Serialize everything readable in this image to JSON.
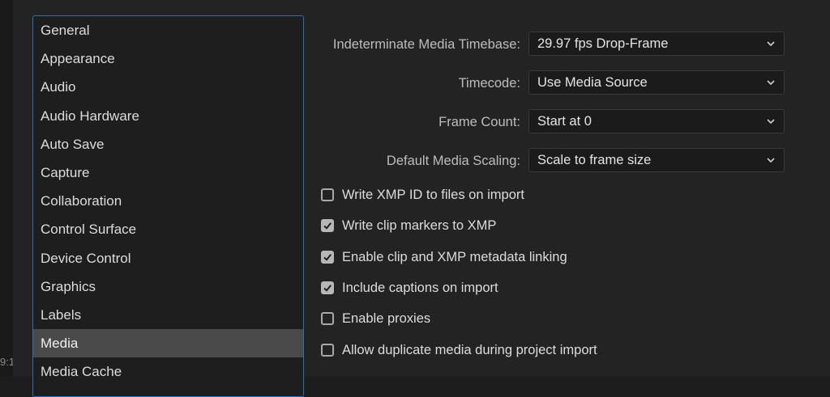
{
  "gutter": {
    "text": "9:1"
  },
  "sidebar": {
    "items": [
      {
        "label": "General"
      },
      {
        "label": "Appearance"
      },
      {
        "label": "Audio"
      },
      {
        "label": "Audio Hardware"
      },
      {
        "label": "Auto Save"
      },
      {
        "label": "Capture"
      },
      {
        "label": "Collaboration"
      },
      {
        "label": "Control Surface"
      },
      {
        "label": "Device Control"
      },
      {
        "label": "Graphics"
      },
      {
        "label": "Labels"
      },
      {
        "label": "Media"
      },
      {
        "label": "Media Cache"
      }
    ],
    "selected": "Media"
  },
  "media": {
    "timebase": {
      "label": "Indeterminate Media Timebase:",
      "value": "29.97 fps Drop-Frame"
    },
    "timecode": {
      "label": "Timecode:",
      "value": "Use Media Source"
    },
    "frame_count": {
      "label": "Frame Count:",
      "value": "Start at 0"
    },
    "scaling": {
      "label": "Default Media Scaling:",
      "value": "Scale to frame size"
    },
    "checkboxes": [
      {
        "label": "Write XMP ID to files on import",
        "checked": false
      },
      {
        "label": "Write clip markers to XMP",
        "checked": true
      },
      {
        "label": "Enable clip and XMP metadata linking",
        "checked": true
      },
      {
        "label": "Include captions on import",
        "checked": true
      },
      {
        "label": "Enable proxies",
        "checked": false
      },
      {
        "label": "Allow duplicate media during project import",
        "checked": false
      }
    ]
  },
  "colors": {
    "accent": "#2f6fb5",
    "selected_bg": "#4a4a4a",
    "panel_bg": "#232323"
  },
  "icons": {
    "dropdown": "chevron-down-icon",
    "check": "checkmark-icon"
  }
}
